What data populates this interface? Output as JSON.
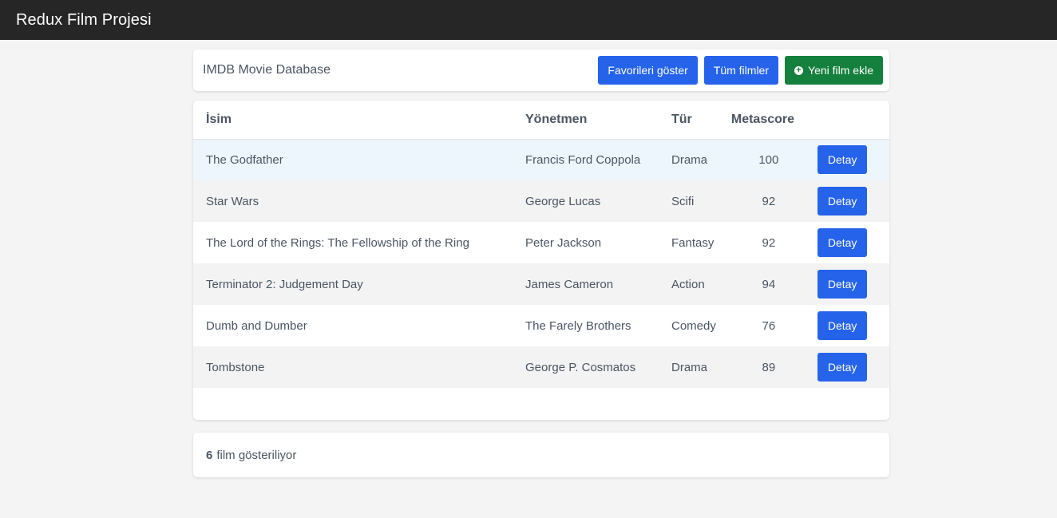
{
  "navbar": {
    "title": "Redux Film Projesi"
  },
  "header": {
    "title": "IMDB Movie Database",
    "buttons": {
      "favorites": "Favorileri göster",
      "all_movies": "Tüm filmler",
      "add_movie": "Yeni film ekle"
    }
  },
  "table": {
    "columns": [
      "İsim",
      "Yönetmen",
      "Tür",
      "Metascore"
    ],
    "rows": [
      {
        "name": "The Godfather",
        "director": "Francis Ford Coppola",
        "genre": "Drama",
        "metascore": "100",
        "action": "Detay"
      },
      {
        "name": "Star Wars",
        "director": "George Lucas",
        "genre": "Scifi",
        "metascore": "92",
        "action": "Detay"
      },
      {
        "name": "The Lord of the Rings: The Fellowship of the Ring",
        "director": "Peter Jackson",
        "genre": "Fantasy",
        "metascore": "92",
        "action": "Detay"
      },
      {
        "name": "Terminator 2: Judgement Day",
        "director": "James Cameron",
        "genre": "Action",
        "metascore": "94",
        "action": "Detay"
      },
      {
        "name": "Dumb and Dumber",
        "director": "The Farely Brothers",
        "genre": "Comedy",
        "metascore": "76",
        "action": "Detay"
      },
      {
        "name": "Tombstone",
        "director": "George P. Cosmatos",
        "genre": "Drama",
        "metascore": "89",
        "action": "Detay"
      }
    ]
  },
  "footer": {
    "count": "6",
    "text": "film gösteriliyor"
  },
  "colors": {
    "navbar": "#262626",
    "primary": "#2563eb",
    "success": "#15803d",
    "row_highlight": "#eef6fd"
  },
  "icons": {
    "add": "plus-circle-icon"
  }
}
